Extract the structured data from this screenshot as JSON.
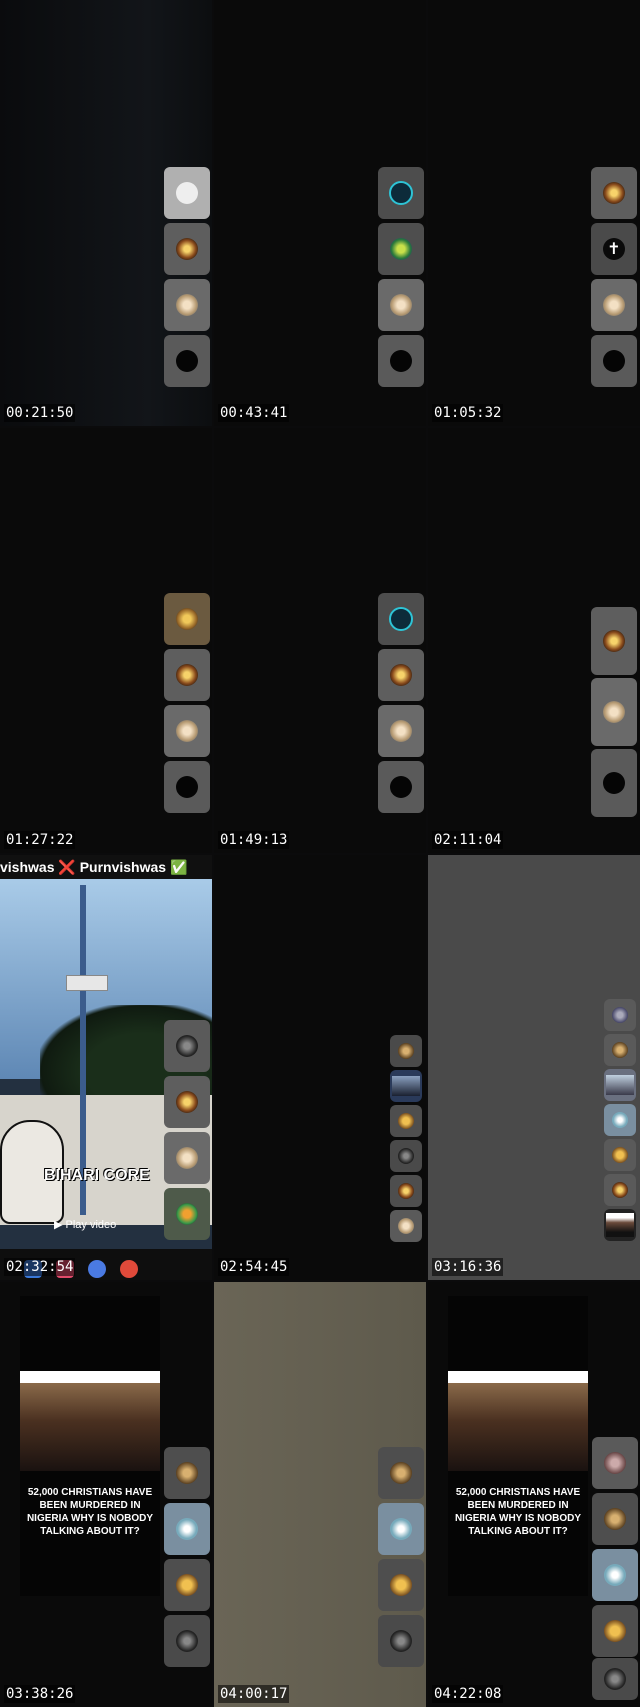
{
  "frames": [
    {
      "timestamp": "00:21:50"
    },
    {
      "timestamp": "00:43:41"
    },
    {
      "timestamp": "01:05:32"
    },
    {
      "timestamp": "01:27:22"
    },
    {
      "timestamp": "01:49:13"
    },
    {
      "timestamp": "02:11:04"
    },
    {
      "timestamp": "02:32:54"
    },
    {
      "timestamp": "02:54:45"
    },
    {
      "timestamp": "03:16:36"
    },
    {
      "timestamp": "03:38:26"
    },
    {
      "timestamp": "04:00:17"
    },
    {
      "timestamp": "04:22:08"
    }
  ],
  "frame7": {
    "header_left": "vishwas",
    "header_cross": "❌",
    "header_right": "Purnvishwas",
    "header_check": "✅",
    "sign_text": "BIHARI CORE",
    "play_label": "Play video"
  },
  "post_caption": "52,000 CHRISTIANS HAVE BEEN MURDERED IN NIGERIA WHY IS NOBODY TALKING ABOUT IT?",
  "icons": {
    "avatar": "avatar-icon",
    "jesus_king": "jesus-king-badge-icon",
    "globe": "globe-icon",
    "cross": "cross-icon",
    "halo": "halo-figure-icon"
  }
}
